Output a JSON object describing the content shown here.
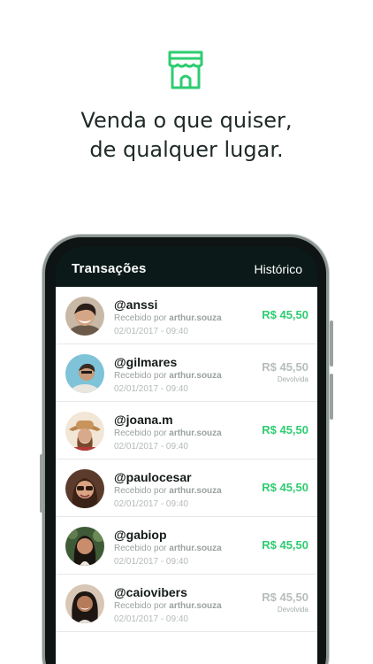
{
  "headline": {
    "line1": "Venda o que quiser,",
    "line2": "de qualquer lugar."
  },
  "colors": {
    "accent": "#2ecc71",
    "dark": "#0b1a18",
    "muted": "#9aa1a0"
  },
  "icons": {
    "top": "store-icon"
  },
  "app": {
    "title": "Transações",
    "history": "Histórico"
  },
  "transactions": [
    {
      "handle": "@anssi",
      "received_prefix": "Recebido por",
      "received_by": "arthur.souza",
      "date": "02/01/2017 - 09:40",
      "amount": "R$ 45,50",
      "status": ""
    },
    {
      "handle": "@gilmares",
      "received_prefix": "Recebido por",
      "received_by": "arthur.souza",
      "date": "02/01/2017 - 09:40",
      "amount": "R$ 45,50",
      "status": "Devolvida"
    },
    {
      "handle": "@joana.m",
      "received_prefix": "Recebido por",
      "received_by": "arthur.souza",
      "date": "02/01/2017 - 09:40",
      "amount": "R$ 45,50",
      "status": ""
    },
    {
      "handle": "@paulocesar",
      "received_prefix": "Recebido por",
      "received_by": "arthur.souza",
      "date": "02/01/2017 - 09:40",
      "amount": "R$ 45,50",
      "status": ""
    },
    {
      "handle": "@gabiop",
      "received_prefix": "Recebido por",
      "received_by": "arthur.souza",
      "date": "02/01/2017 - 09:40",
      "amount": "R$ 45,50",
      "status": ""
    },
    {
      "handle": "@caiovibers",
      "received_prefix": "Recebido por",
      "received_by": "arthur.souza",
      "date": "02/01/2017 - 09:40",
      "amount": "R$ 45,50",
      "status": "Devolvida"
    }
  ]
}
